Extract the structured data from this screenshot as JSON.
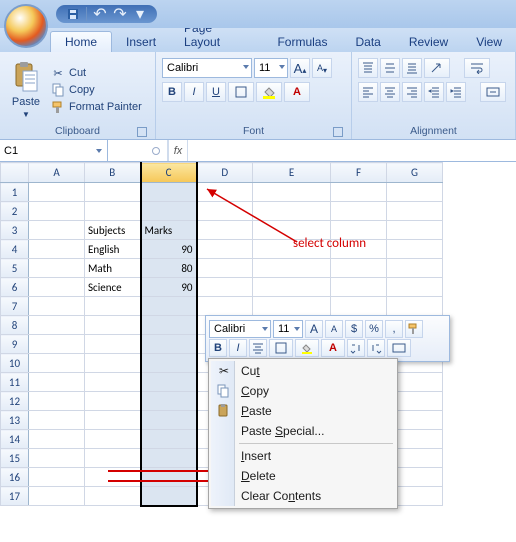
{
  "qat": {
    "save": "💾",
    "undo": "↶",
    "redo": "↷"
  },
  "tabs": {
    "home": "Home",
    "insert": "Insert",
    "page_layout": "Page Layout",
    "formulas": "Formulas",
    "data": "Data",
    "review": "Review",
    "view": "View"
  },
  "clipboard": {
    "label": "Clipboard",
    "paste": "Paste",
    "cut": "Cut",
    "copy": "Copy",
    "format_painter": "Format Painter"
  },
  "font": {
    "label": "Font",
    "name": "Calibri",
    "size": "11",
    "bold": "B",
    "italic": "I",
    "underline": "U",
    "grow": "A",
    "shrink": "A"
  },
  "alignment": {
    "label": "Alignment"
  },
  "namebox": "C1",
  "formula": "",
  "fx": "fx",
  "columns": [
    "A",
    "B",
    "C",
    "D",
    "E",
    "F",
    "G"
  ],
  "rows": [
    "1",
    "2",
    "3",
    "4",
    "5",
    "6",
    "7",
    "8",
    "9",
    "10",
    "11",
    "12",
    "13",
    "14",
    "15",
    "16",
    "17"
  ],
  "cells": {
    "B3": "Subjects",
    "C3": "Marks",
    "B4": "English",
    "C4": "90",
    "B5": "Math",
    "C5": "80",
    "B6": "Science",
    "C6": "90"
  },
  "annotation": {
    "select_column": "select column"
  },
  "mini": {
    "font": "Calibri",
    "size": "11",
    "grow": "A",
    "shrink": "A",
    "currency": "$",
    "percent": "%",
    "comma": ",",
    "bold": "B",
    "italic": "I"
  },
  "context_menu": {
    "cut": "Cut",
    "copy": "Copy",
    "paste": "Paste",
    "paste_special": "Paste Special...",
    "insert": "Insert",
    "delete": "Delete",
    "clear_contents": "Clear Contents"
  }
}
